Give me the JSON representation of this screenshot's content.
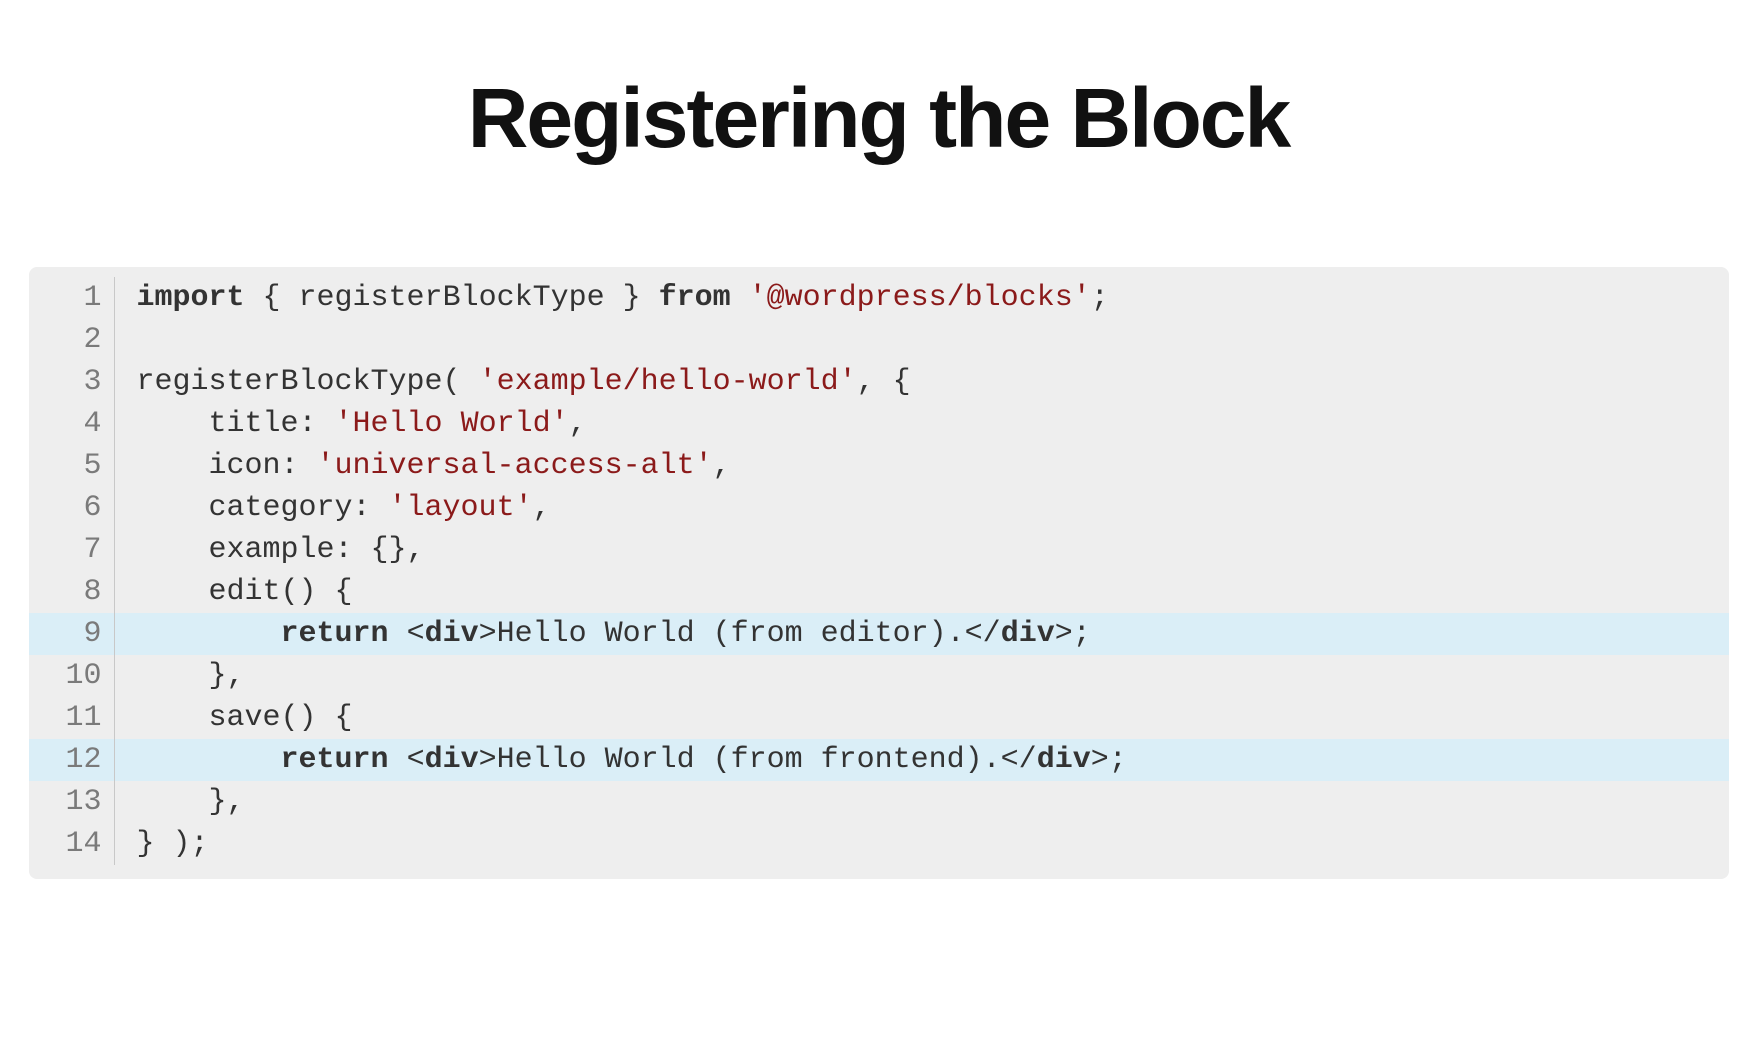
{
  "title": "Registering the Block",
  "code": {
    "highlighted_lines": [
      9,
      12
    ],
    "lines": [
      {
        "n": 1,
        "tokens": [
          {
            "t": "import",
            "c": "kw"
          },
          {
            "t": " { registerBlockType } "
          },
          {
            "t": "from",
            "c": "kw"
          },
          {
            "t": " "
          },
          {
            "t": "'@wordpress/blocks'",
            "c": "str"
          },
          {
            "t": ";"
          }
        ]
      },
      {
        "n": 2,
        "tokens": [
          {
            "t": " "
          }
        ]
      },
      {
        "n": 3,
        "tokens": [
          {
            "t": "registerBlockType( "
          },
          {
            "t": "'example/hello-world'",
            "c": "str"
          },
          {
            "t": ", {"
          }
        ]
      },
      {
        "n": 4,
        "tokens": [
          {
            "t": "    title: "
          },
          {
            "t": "'Hello World'",
            "c": "str"
          },
          {
            "t": ","
          }
        ]
      },
      {
        "n": 5,
        "tokens": [
          {
            "t": "    icon: "
          },
          {
            "t": "'universal-access-alt'",
            "c": "str"
          },
          {
            "t": ","
          }
        ]
      },
      {
        "n": 6,
        "tokens": [
          {
            "t": "    category: "
          },
          {
            "t": "'layout'",
            "c": "str"
          },
          {
            "t": ","
          }
        ]
      },
      {
        "n": 7,
        "tokens": [
          {
            "t": "    example: {},"
          }
        ]
      },
      {
        "n": 8,
        "tokens": [
          {
            "t": "    edit() {"
          }
        ]
      },
      {
        "n": 9,
        "tokens": [
          {
            "t": "        "
          },
          {
            "t": "return",
            "c": "kw"
          },
          {
            "t": " <"
          },
          {
            "t": "div",
            "c": "tag"
          },
          {
            "t": ">Hello World (from editor).</"
          },
          {
            "t": "div",
            "c": "tag"
          },
          {
            "t": ">;"
          }
        ]
      },
      {
        "n": 10,
        "tokens": [
          {
            "t": "    },"
          }
        ]
      },
      {
        "n": 11,
        "tokens": [
          {
            "t": "    save() {"
          }
        ]
      },
      {
        "n": 12,
        "tokens": [
          {
            "t": "        "
          },
          {
            "t": "return",
            "c": "kw"
          },
          {
            "t": " <"
          },
          {
            "t": "div",
            "c": "tag"
          },
          {
            "t": ">Hello World (from frontend).</"
          },
          {
            "t": "div",
            "c": "tag"
          },
          {
            "t": ">;"
          }
        ]
      },
      {
        "n": 13,
        "tokens": [
          {
            "t": "    },"
          }
        ]
      },
      {
        "n": 14,
        "tokens": [
          {
            "t": "} );"
          }
        ]
      }
    ]
  }
}
